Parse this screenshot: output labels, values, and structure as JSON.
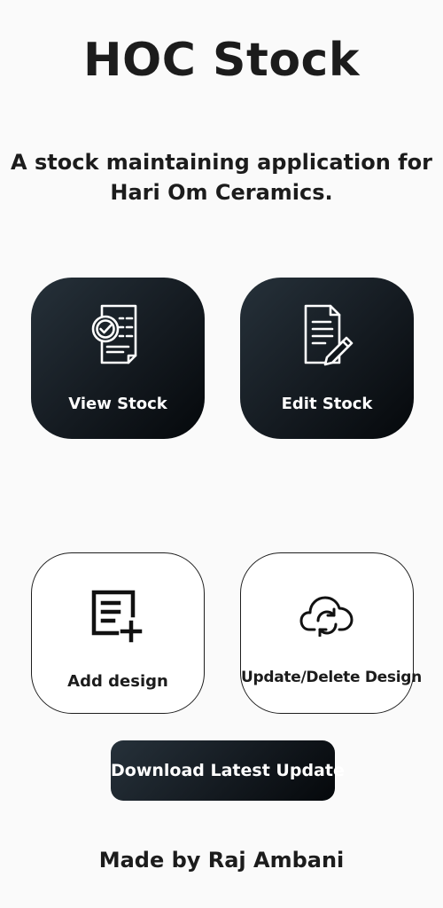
{
  "header": {
    "title": "HOC Stock",
    "subtitle": "A stock maintaining application for Hari Om Ceramics."
  },
  "cards": {
    "view_stock": {
      "label": "View Stock",
      "icon": "stock-check-icon"
    },
    "edit_stock": {
      "label": "Edit Stock",
      "icon": "edit-document-icon"
    },
    "add_design": {
      "label": "Add design",
      "icon": "add-post-icon"
    },
    "update_delete_design": {
      "label": "Update/Delete Design",
      "icon": "cloud-sync-icon"
    }
  },
  "download": {
    "label": "Download Latest Update"
  },
  "footer": {
    "text": "Made by Raj Ambani"
  },
  "colors": {
    "background": "#fafafa",
    "dark_card": "#141a20",
    "light_card": "#ffffff"
  }
}
